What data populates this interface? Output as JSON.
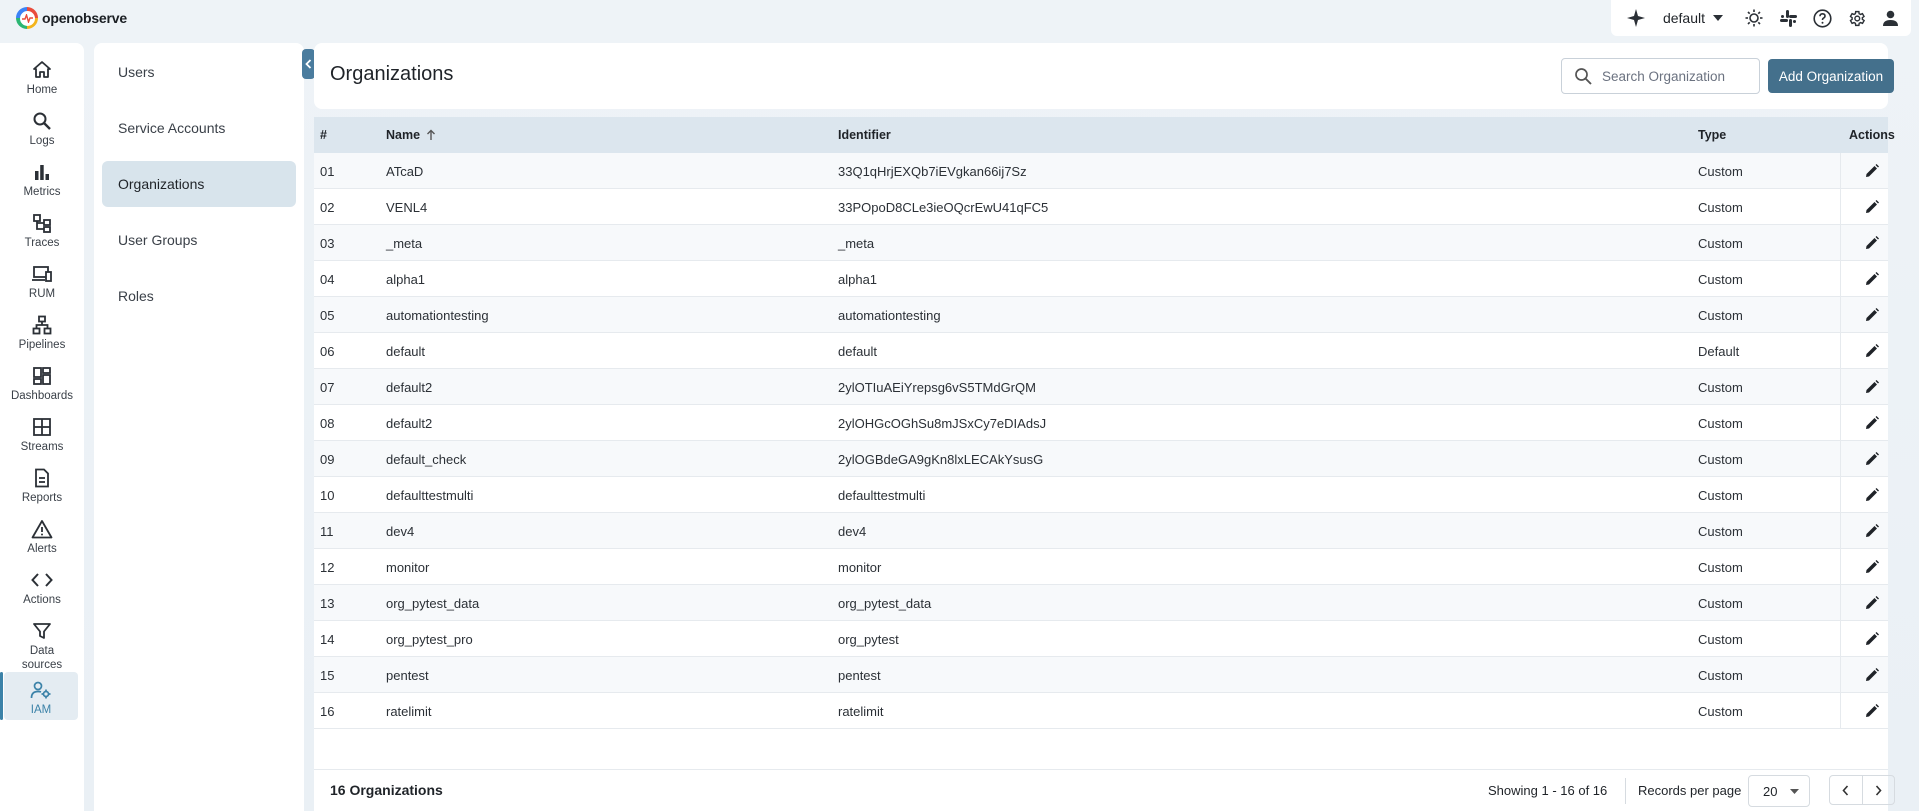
{
  "brand": {
    "name": "openobserve"
  },
  "topbar": {
    "org_selected": "default",
    "icons": [
      "sparkle-icon",
      "sun-icon",
      "slack-icon",
      "help-icon",
      "gear-icon",
      "user-icon"
    ]
  },
  "nav": {
    "items": [
      {
        "label": "Home",
        "icon": "home-icon"
      },
      {
        "label": "Logs",
        "icon": "search-icon"
      },
      {
        "label": "Metrics",
        "icon": "bar-chart-icon"
      },
      {
        "label": "Traces",
        "icon": "traces-icon"
      },
      {
        "label": "RUM",
        "icon": "devices-icon"
      },
      {
        "label": "Pipelines",
        "icon": "pipeline-icon"
      },
      {
        "label": "Dashboards",
        "icon": "dashboard-icon"
      },
      {
        "label": "Streams",
        "icon": "streams-icon"
      },
      {
        "label": "Reports",
        "icon": "report-icon"
      },
      {
        "label": "Alerts",
        "icon": "alert-icon"
      },
      {
        "label": "Actions",
        "icon": "code-icon"
      },
      {
        "label": "Data sources",
        "icon": "filter-icon"
      },
      {
        "label": "IAM",
        "icon": "iam-icon",
        "active": true
      }
    ]
  },
  "submenu": {
    "items": [
      "Users",
      "Service Accounts",
      "Organizations",
      "User Groups",
      "Roles"
    ],
    "active": "Organizations"
  },
  "header": {
    "title": "Organizations",
    "search_placeholder": "Search Organization",
    "add_label": "Add Organization"
  },
  "table": {
    "columns": {
      "num": "#",
      "name": "Name",
      "identifier": "Identifier",
      "type": "Type",
      "actions": "Actions"
    },
    "rows": [
      {
        "num": "01",
        "name": "ATcaD",
        "identifier": "33Q1qHrjEXQb7iEVgkan66ij7Sz",
        "type": "Custom"
      },
      {
        "num": "02",
        "name": "VENL4",
        "identifier": "33POpoD8CLe3ieOQcrEwU41qFC5",
        "type": "Custom"
      },
      {
        "num": "03",
        "name": "_meta",
        "identifier": "_meta",
        "type": "Custom"
      },
      {
        "num": "04",
        "name": "alpha1",
        "identifier": "alpha1",
        "type": "Custom"
      },
      {
        "num": "05",
        "name": "automationtesting",
        "identifier": "automationtesting",
        "type": "Custom"
      },
      {
        "num": "06",
        "name": "default",
        "identifier": "default",
        "type": "Default"
      },
      {
        "num": "07",
        "name": "default2",
        "identifier": "2ylOTIuAEiYrepsg6vS5TMdGrQM",
        "type": "Custom"
      },
      {
        "num": "08",
        "name": "default2",
        "identifier": "2ylOHGcOGhSu8mJSxCy7eDIAdsJ",
        "type": "Custom"
      },
      {
        "num": "09",
        "name": "default_check",
        "identifier": "2ylOGBdeGA9gKn8lxLECAkYsusG",
        "type": "Custom"
      },
      {
        "num": "10",
        "name": "defaulttestmulti",
        "identifier": "defaulttestmulti",
        "type": "Custom"
      },
      {
        "num": "11",
        "name": "dev4",
        "identifier": "dev4",
        "type": "Custom"
      },
      {
        "num": "12",
        "name": "monitor",
        "identifier": "monitor",
        "type": "Custom"
      },
      {
        "num": "13",
        "name": "org_pytest_data",
        "identifier": "org_pytest_data",
        "type": "Custom"
      },
      {
        "num": "14",
        "name": "org_pytest_pro",
        "identifier": "org_pytest",
        "type": "Custom"
      },
      {
        "num": "15",
        "name": "pentest",
        "identifier": "pentest",
        "type": "Custom"
      },
      {
        "num": "16",
        "name": "ratelimit",
        "identifier": "ratelimit",
        "type": "Custom"
      }
    ]
  },
  "footer": {
    "count_label": "16 Organizations",
    "showing": "Showing 1 - 16 of 16",
    "records_per_page_label": "Records per page",
    "records_per_page": "20"
  },
  "colors": {
    "accent": "#44708c",
    "active_nav": "#3b82a8",
    "header_row": "#dce6ee"
  }
}
